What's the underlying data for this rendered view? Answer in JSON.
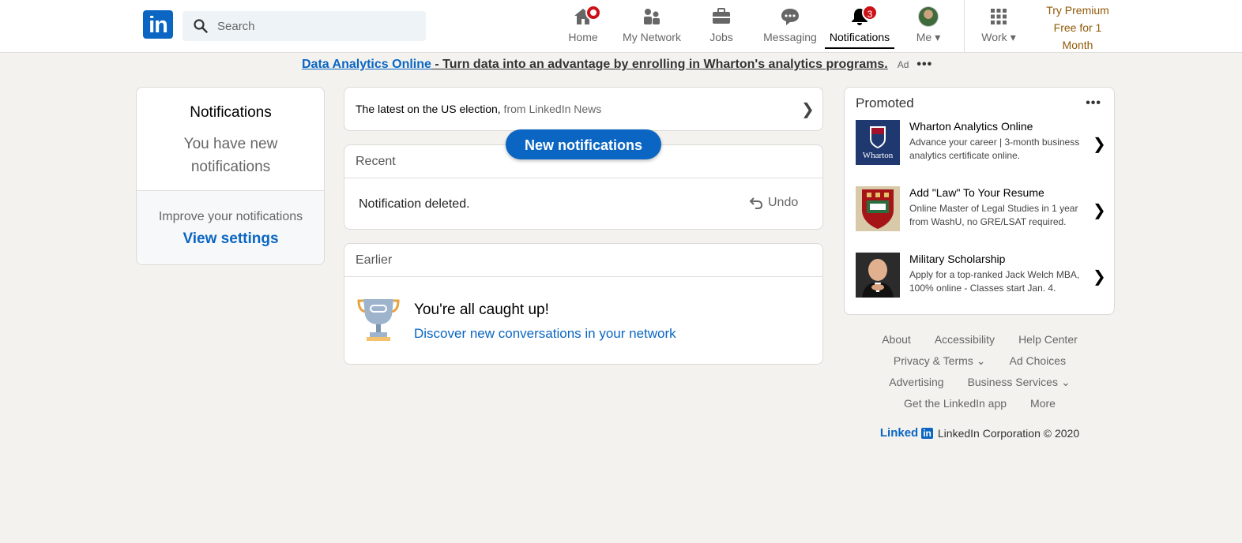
{
  "nav": {
    "logo": "in",
    "search_placeholder": "Search",
    "items": [
      {
        "label": "Home"
      },
      {
        "label": "My Network"
      },
      {
        "label": "Jobs"
      },
      {
        "label": "Messaging"
      },
      {
        "label": "Notifications",
        "badge": "3"
      },
      {
        "label": "Me"
      },
      {
        "label": "Work"
      }
    ],
    "premium_line1": "Try Premium",
    "premium_line2": "Free for 1",
    "premium_line3": "Month"
  },
  "ad": {
    "link": "Data Analytics Online",
    "text": " - Turn data into an advantage by enrolling in Wharton's analytics programs.",
    "tag": "Ad",
    "dots": "•••"
  },
  "left": {
    "title": "Notifications",
    "subtitle": "You have new notifications",
    "improve": "Improve your notifications",
    "settings": "View settings"
  },
  "news": {
    "text": "The latest on the US election,",
    "source": " from LinkedIn News"
  },
  "new_notifications": "New notifications",
  "recent": {
    "header": "Recent",
    "message": "Notification deleted.",
    "undo": "Undo"
  },
  "earlier": {
    "header": "Earlier",
    "caught_up": "You're all caught up!",
    "discover": "Discover new conversations in your network"
  },
  "promoted": {
    "title": "Promoted",
    "dots": "•••",
    "items": [
      {
        "name": "Wharton Analytics Online",
        "desc": "Advance your career | 3-month business analytics certificate online.",
        "img_text": "Wharton"
      },
      {
        "name": "Add \"Law\" To Your Resume",
        "desc": "Online Master of Legal Studies in 1 year from WashU, no GRE/LSAT required."
      },
      {
        "name": "Military Scholarship",
        "desc": "Apply for a top-ranked Jack Welch MBA, 100% online - Classes start Jan. 4."
      }
    ]
  },
  "footer": {
    "about": "About",
    "accessibility": "Accessibility",
    "help": "Help Center",
    "privacy": "Privacy & Terms",
    "adchoices": "Ad Choices",
    "advertising": "Advertising",
    "business": "Business Services",
    "app": "Get the LinkedIn app",
    "more": "More",
    "brand_word": "Linked",
    "brand_box": "in",
    "copyright": "LinkedIn Corporation © 2020"
  },
  "colors": {
    "brand": "#0a66c2",
    "badge": "#cc1016",
    "premium": "#915907"
  }
}
